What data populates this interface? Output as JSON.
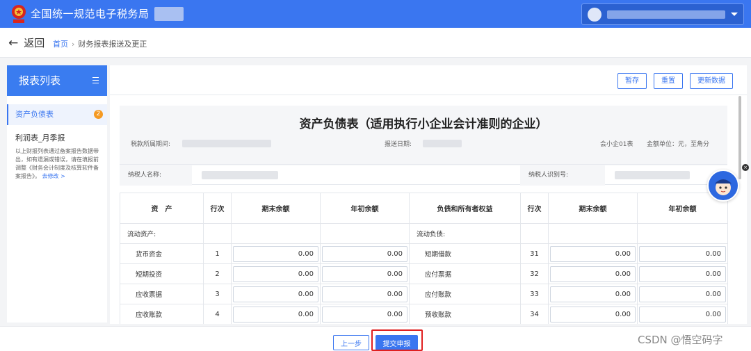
{
  "header": {
    "site_title": "全国统一规范电子税务局"
  },
  "nav": {
    "back_label": "返回",
    "breadcrumb": {
      "home": "首页",
      "current": "财务报表报送及更正"
    }
  },
  "sidebar": {
    "title": "报表列表",
    "items": [
      {
        "label": "资产负债表",
        "badge": "2"
      },
      {
        "label": "利润表_月季报"
      }
    ],
    "note": "以上财报列表通过备案报告数据带出，如有遗漏或错误，请在填报前调整《财务会计制度及核算软件备案报告》。",
    "note_link": "去修改 >"
  },
  "toolbar": {
    "save_label": "暂存",
    "reset_label": "重置",
    "refresh_label": "更新数据"
  },
  "report": {
    "title": "资产负债表（适用执行小企业会计准则的企业）",
    "period_label": "税款所属期间:",
    "submit_date_label": "报送日期:",
    "form_code": "会小企01表",
    "unit": "金额单位：元，至角分",
    "taxpayer_name_label": "纳税人名称:",
    "taxpayer_id_label": "纳税人识别号:"
  },
  "table": {
    "headers": {
      "asset": "资　产",
      "row_no": "行次",
      "end_balance": "期末余额",
      "begin_balance": "年初余额",
      "liability": "负债和所有者权益"
    },
    "section_left": "流动资产:",
    "section_right": "流动负债:",
    "rows": [
      {
        "left_label": "货币资金",
        "left_no": "1",
        "left_end": "0.00",
        "left_begin": "0.00",
        "right_label": "短期借款",
        "right_no": "31",
        "right_end": "0.00",
        "right_begin": "0.00"
      },
      {
        "left_label": "短期投资",
        "left_no": "2",
        "left_end": "0.00",
        "left_begin": "0.00",
        "right_label": "应付票据",
        "right_no": "32",
        "right_end": "0.00",
        "right_begin": "0.00"
      },
      {
        "left_label": "应收票据",
        "left_no": "3",
        "left_end": "0.00",
        "left_begin": "0.00",
        "right_label": "应付账款",
        "right_no": "33",
        "right_end": "0.00",
        "right_begin": "0.00"
      },
      {
        "left_label": "应收账款",
        "left_no": "4",
        "left_end": "0.00",
        "left_begin": "0.00",
        "right_label": "预收账款",
        "right_no": "34",
        "right_end": "0.00",
        "right_begin": "0.00"
      }
    ]
  },
  "footer": {
    "prev_label": "上一步",
    "submit_label": "提交申报"
  },
  "watermark": "CSDN @悟空码字",
  "colors": {
    "primary": "#3a76f0",
    "badge": "#f59a23",
    "highlight": "#e02020"
  },
  "icons": [
    "emblem-icon",
    "user-avatar-icon",
    "caret-down-icon",
    "back-arrow-icon",
    "collapse-menu-icon",
    "assistant-mascot-icon"
  ]
}
